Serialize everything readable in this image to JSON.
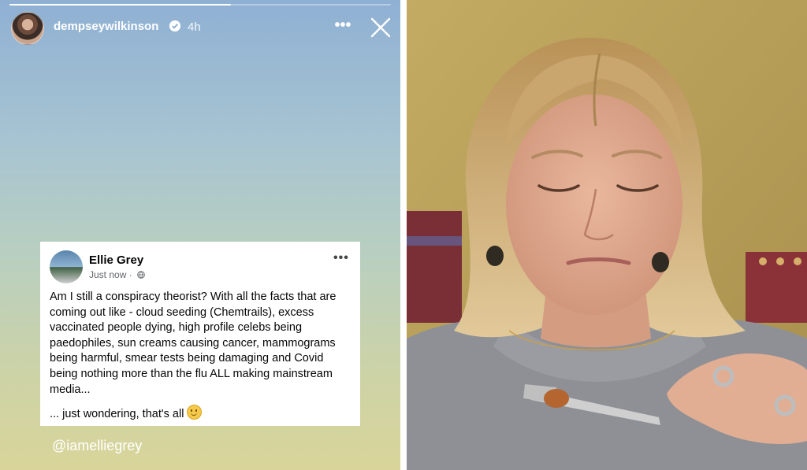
{
  "story": {
    "username": "dempseywilkinson",
    "time_ago": "4h",
    "progress": 0.58,
    "more_icon": "more-horizontal-icon",
    "close_icon": "close-icon",
    "verified_icon": "verified-badge-icon",
    "handle": "@iamelliegrey"
  },
  "post": {
    "author": "Ellie Grey",
    "timestamp": "Just now",
    "separator": " · ",
    "privacy_icon": "globe-icon",
    "body": "Am I still a conspiracy theorist? With all the facts that are coming out like - cloud seeding (Chemtrails), excess vaccinated people dying, high profile celebs being paedophiles, sun creams causing cancer, mammograms being harmful, smear tests being damaging and Covid being nothing more than the flu ALL making mainstream media...",
    "footer": "... just wondering, that's all",
    "emoji_icon": "slightly-smiling-face-icon"
  },
  "colors": {
    "story_top": "#8fb0d3",
    "story_bottom": "#d9d59a",
    "card_bg": "#ffffff",
    "wall": "#b69d55",
    "sweater": "#8e9096"
  }
}
